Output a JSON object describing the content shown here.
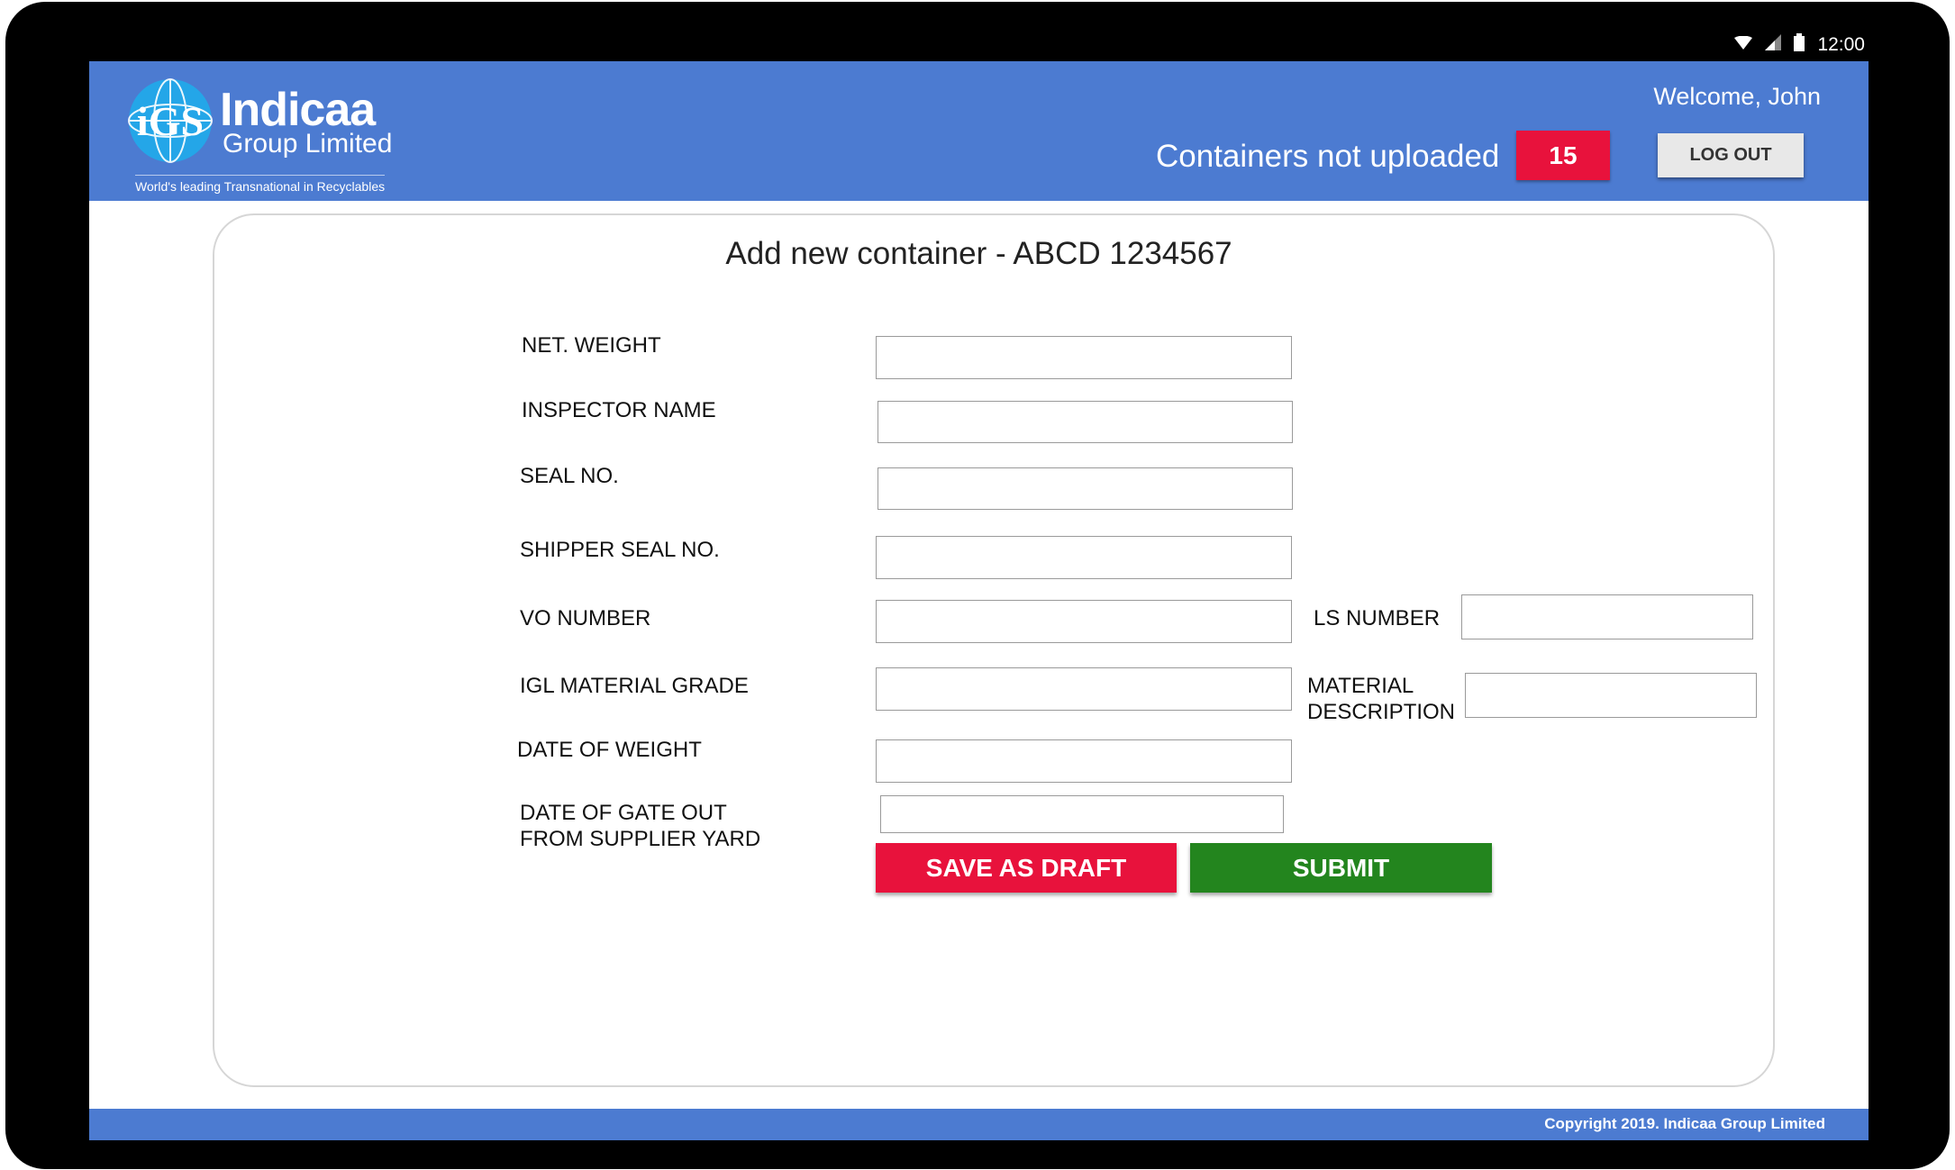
{
  "status_bar": {
    "time": "12:00",
    "icons": [
      "wifi-icon",
      "signal-icon",
      "battery-icon"
    ]
  },
  "header": {
    "logo": {
      "mark": "iGS",
      "name": "Indicaa",
      "subname": "Group Limited",
      "tagline": "World's leading Transnational in Recyclables"
    },
    "welcome": "Welcome, John",
    "pending_label": "Containers not uploaded",
    "pending_count": "15",
    "logout_label": "LOG OUT"
  },
  "form": {
    "title": "Add new container - ABCD 1234567",
    "fields": {
      "net_weight": {
        "label": "NET. WEIGHT",
        "value": ""
      },
      "inspector_name": {
        "label": "INSPECTOR NAME",
        "value": ""
      },
      "seal_no": {
        "label": "SEAL NO.",
        "value": ""
      },
      "shipper_seal_no": {
        "label": "SHIPPER SEAL NO.",
        "value": ""
      },
      "vo_number": {
        "label": "VO NUMBER",
        "value": ""
      },
      "ls_number": {
        "label": "LS NUMBER",
        "value": ""
      },
      "igl_material_grade": {
        "label": "IGL MATERIAL GRADE",
        "value": ""
      },
      "material_description": {
        "label_line1": "MATERIAL",
        "label_line2": "DESCRIPTION",
        "value": ""
      },
      "date_of_weight": {
        "label": "DATE OF WEIGHT",
        "value": ""
      },
      "date_gate_out": {
        "label_line1": "DATE OF GATE OUT",
        "label_line2": "FROM SUPPLIER YARD",
        "value": ""
      }
    },
    "save_draft_label": "SAVE AS DRAFT",
    "submit_label": "SUBMIT"
  },
  "footer": {
    "copyright": "Copyright 2019. Indicaa Group Limited"
  },
  "colors": {
    "header_blue": "#4c7bd1",
    "badge_red": "#e8123c",
    "submit_green": "#23851e"
  }
}
